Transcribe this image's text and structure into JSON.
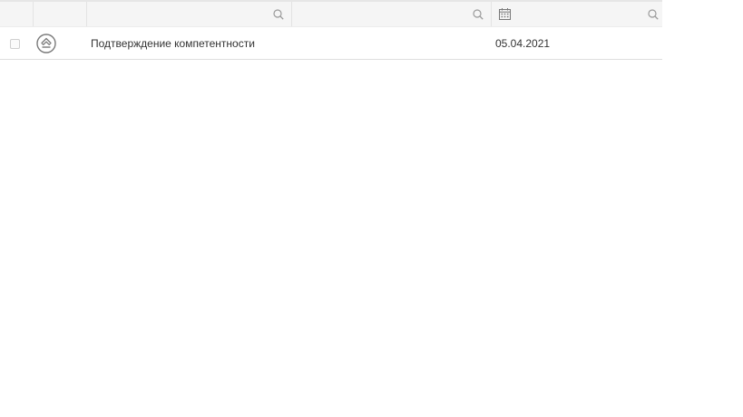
{
  "table": {
    "filter_row": {
      "columns": [
        {
          "filter": "none"
        },
        {
          "filter": "none"
        },
        {
          "filter": "search-icon"
        },
        {
          "filter": "search-icon"
        },
        {
          "filter": "calendar-icon+search-icon"
        }
      ]
    },
    "rows": [
      {
        "checked": false,
        "status_icon": "status-circle-icon",
        "name": "Подтверждение компетентности",
        "empty": "",
        "date": "05.04.2021"
      }
    ]
  }
}
